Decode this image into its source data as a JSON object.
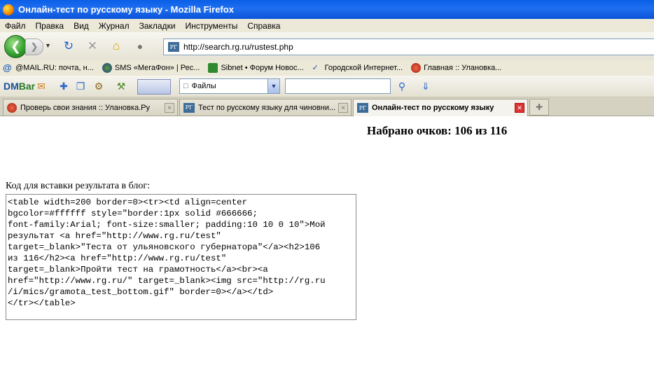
{
  "window": {
    "title": "Онлайн-тест по русскому языку - Mozilla Firefox"
  },
  "menu": [
    "Файл",
    "Правка",
    "Вид",
    "Журнал",
    "Закладки",
    "Инструменты",
    "Справка"
  ],
  "nav": {
    "url": "http://search.rg.ru/rustest.php",
    "favicon": "РГ"
  },
  "bookmarks": [
    {
      "label": "@MAIL.RU: почта, н...",
      "icon": "mailru-icon"
    },
    {
      "label": "SMS «МегаФон» | Рес...",
      "icon": "megafon-icon"
    },
    {
      "label": "Sibnet • Форум Новос...",
      "icon": "sibnet-icon"
    },
    {
      "label": "Городской Интернет...",
      "icon": "city-internet-icon"
    },
    {
      "label": "Главная :: Улановка...",
      "icon": "ulanovka-icon"
    }
  ],
  "dmbar": {
    "logo_dm": "DM",
    "logo_bar": "Bar",
    "select_value": "Файлы"
  },
  "tabs": [
    {
      "label": "Проверь свои знания :: Улановка.Ру",
      "favicon": "ulanovka-icon"
    },
    {
      "label": "Тест по русскому языку для чиновни...",
      "favicon": "РГ"
    },
    {
      "label": "Онлайн-тест по русскому языку",
      "favicon": "РГ"
    }
  ],
  "content": {
    "score": "Набрано очков: 106 из 116",
    "code_label": "Код для вставки результата в блог:",
    "code": "<table width=200 border=0><tr><td align=center\nbgcolor=#ffffff style=\"border:1px solid #666666;\nfont-family:Arial; font-size:smaller; padding:10 10 0 10\">Мой\nрезультат <a href=\"http://www.rg.ru/test\"\ntarget=_blank>\"Теста от ульяновского губернатора\"</a><h2>106\nиз 116</h2><a href=\"http://www.rg.ru/test\"\ntarget=_blank>Пройти тест на грамотность</a><br><a\nhref=\"http://www.rg.ru/\" target=_blank><img src=\"http://rg.ru\n/i/mics/gramota_test_bottom.gif\" border=0></a></td>\n</tr></table>"
  }
}
